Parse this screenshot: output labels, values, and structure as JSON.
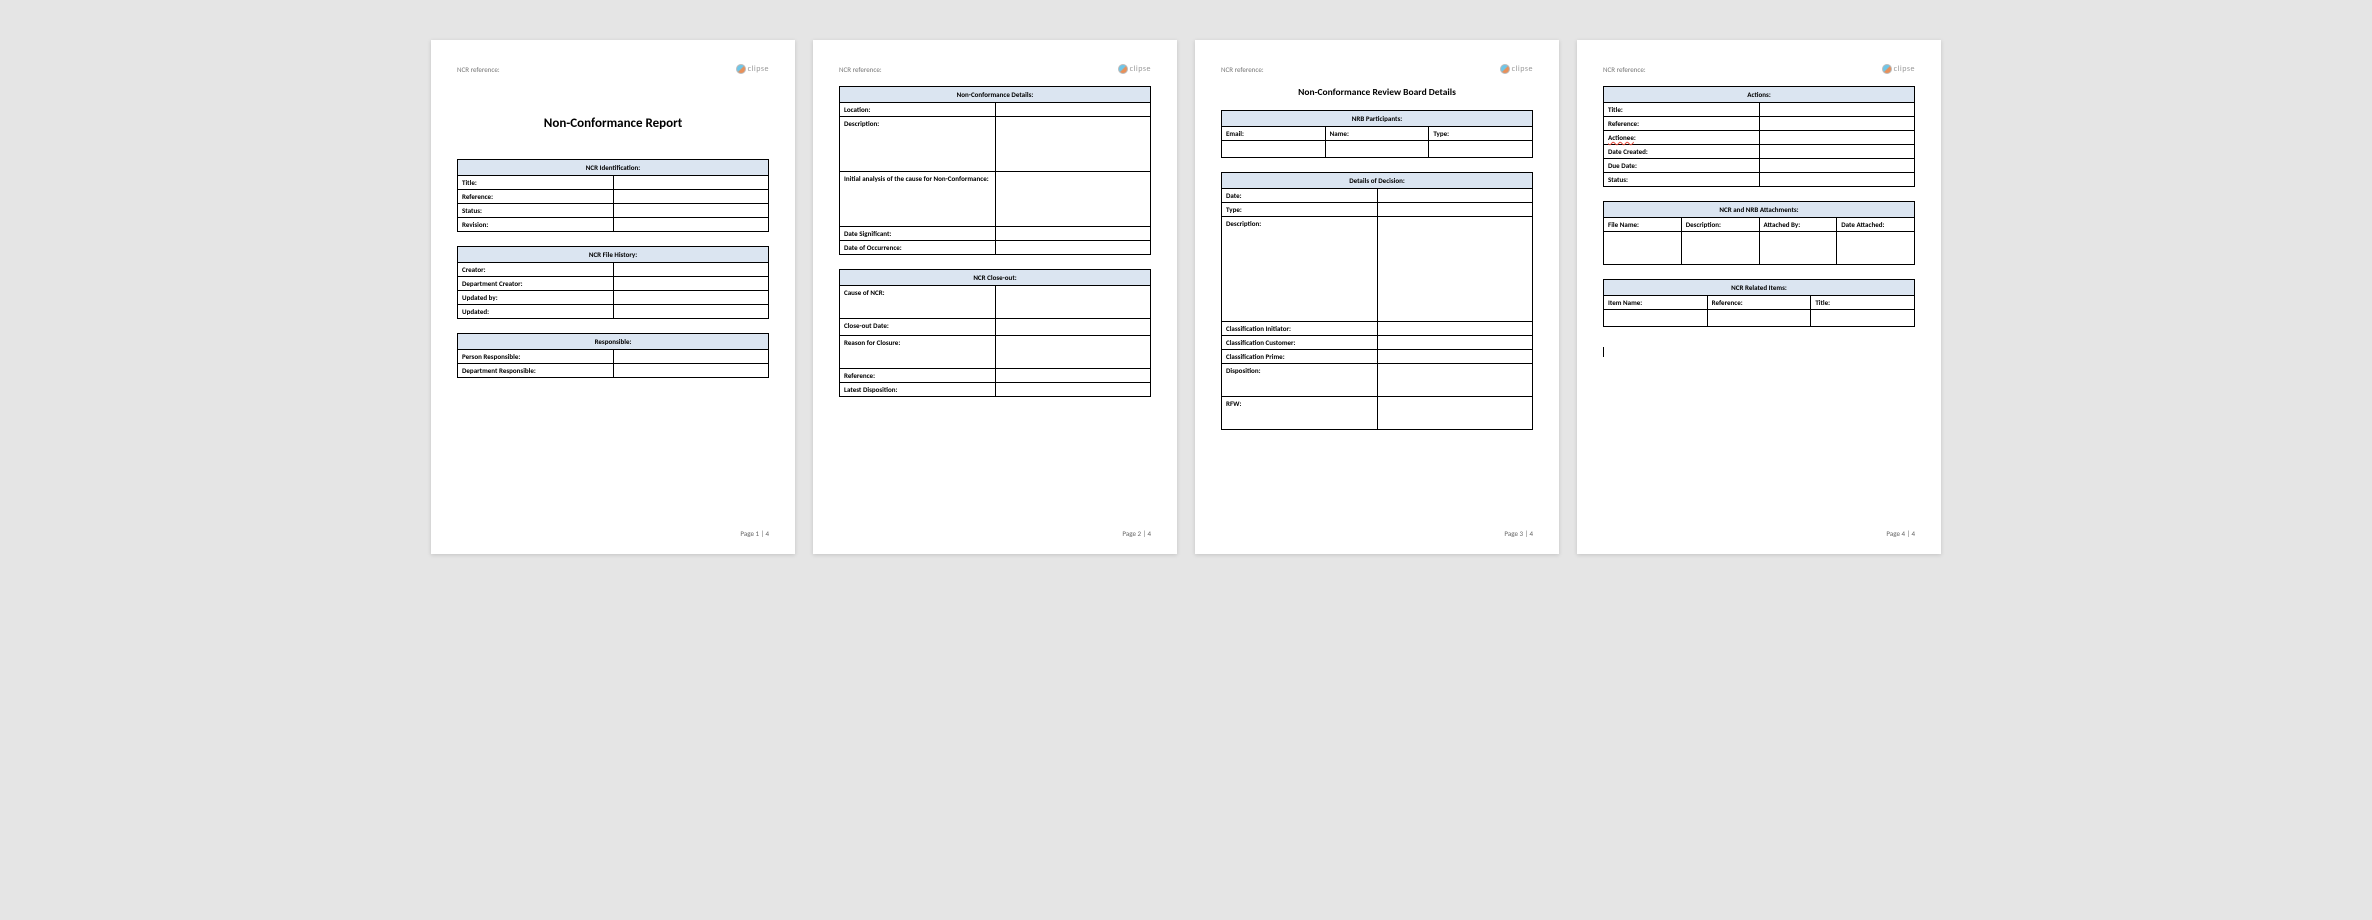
{
  "header": {
    "ncr_ref": "NCR reference:",
    "logo_text": "clipse"
  },
  "footer": {
    "p1": "Page 1 | 4",
    "p2": "Page 2 | 4",
    "p3": "Page 3 | 4",
    "p4": "Page 4 | 4"
  },
  "page1": {
    "title": "Non-Conformance Report",
    "t1": {
      "head": "NCR Identification:",
      "r1": "Title:",
      "r2": "Reference:",
      "r3": "Status:",
      "r4": "Revision:"
    },
    "t2": {
      "head": "NCR File History:",
      "r1": "Creator:",
      "r2": "Department Creator:",
      "r3": "Updated by:",
      "r4": "Updated:"
    },
    "t3": {
      "head": "Responsible:",
      "r1": "Person Responsible:",
      "r2": "Department Responsible:"
    }
  },
  "page2": {
    "t1": {
      "head": "Non-Conformance Details:",
      "r1": "Location:",
      "r2": "Description:",
      "r3": "Initial analysis of the cause for Non-Conformance:",
      "r4": "Date Significant:",
      "r5": "Date of Occurrence:"
    },
    "t2": {
      "head": "NCR Close-out:",
      "r1": "Cause of NCR:",
      "r2": "Close-out Date:",
      "r3": "Reason for Closure:",
      "r4": "Reference:",
      "r5": "Latest Disposition:"
    }
  },
  "page3": {
    "title": "Non-Conformance Review Board Details",
    "t1": {
      "head": "NRB Participants:",
      "c1": "Email:",
      "c2": "Name:",
      "c3": "Type:"
    },
    "t2": {
      "head": "Details of Decision:",
      "r1": "Date:",
      "r2": "Type:",
      "r3": "Description:",
      "r4": "Classification Initiator:",
      "r5": "Classification Customer:",
      "r6": "Classification Prime:",
      "r7": "Disposition:",
      "r8": "RFW:"
    }
  },
  "page4": {
    "t1": {
      "head": "Actions:",
      "r1": "Title:",
      "r2": "Reference:",
      "r3": "Actionee",
      "r3s": ":",
      "r4": "Date Created:",
      "r5": "Due Date:",
      "r6": "Status:"
    },
    "t2": {
      "head": "NCR and NRB Attachments:",
      "c1": "File Name:",
      "c2": "Description:",
      "c3": "Attached By:",
      "c4": "Date Attached:"
    },
    "t3": {
      "head": "NCR Related Items:",
      "c1": "Item Name:",
      "c2": "Reference:",
      "c3": "Title:"
    }
  }
}
